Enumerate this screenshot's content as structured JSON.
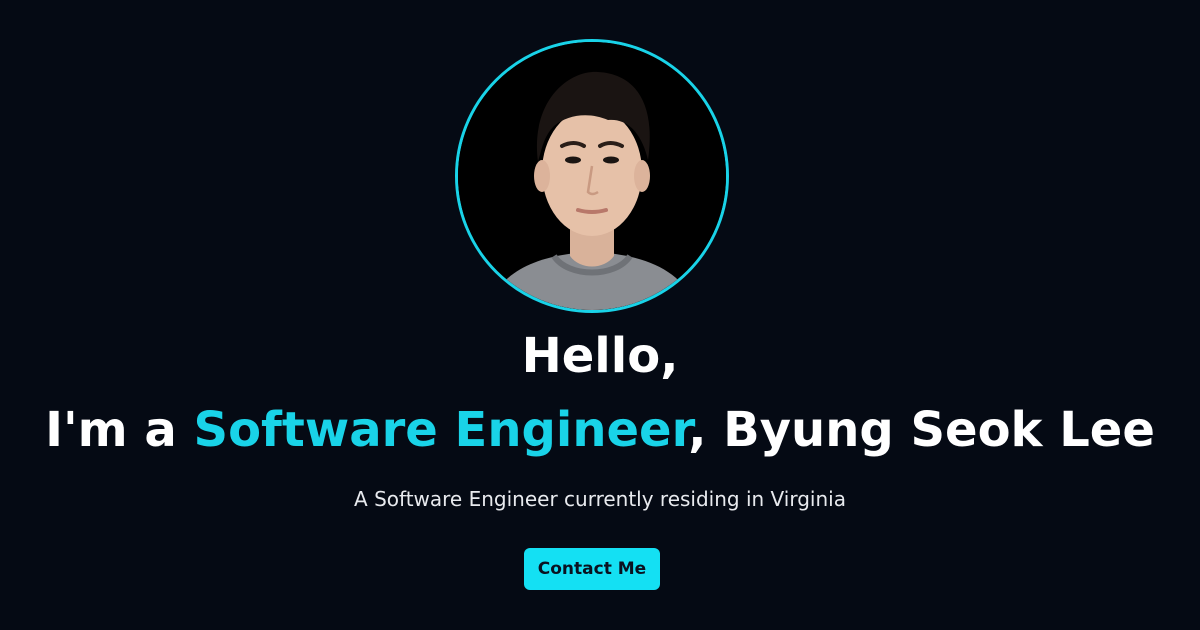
{
  "hero": {
    "greeting": "Hello,",
    "intro_prefix": "I'm a ",
    "role": "Software Engineer",
    "intro_suffix": ", Byung Seok Lee",
    "subtitle": "A Software Engineer currently residing in Virginia",
    "contact_label": "Contact Me"
  },
  "colors": {
    "background": "#050a14",
    "accent": "#19d3e8",
    "button": "#14e0f3",
    "text": "#ffffff"
  },
  "avatar": {
    "icon": "profile-photo"
  }
}
